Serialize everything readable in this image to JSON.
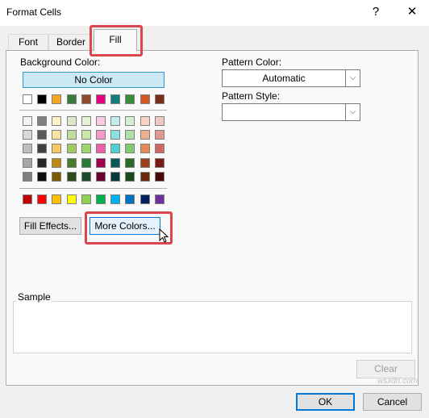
{
  "dialog": {
    "title": "Format Cells",
    "help_label": "?",
    "close_label": "✕"
  },
  "tabs": [
    {
      "label": "Font",
      "selected": false
    },
    {
      "label": "Border",
      "selected": false
    },
    {
      "label": "Fill",
      "selected": true
    }
  ],
  "fill": {
    "background_color_label": "Background Color:",
    "no_color_label": "No Color",
    "pattern_color_label": "Pattern Color:",
    "pattern_color_value": "Automatic",
    "pattern_style_label": "Pattern Style:",
    "pattern_style_value": "",
    "fill_effects_label": "Fill Effects...",
    "more_colors_label": "More Colors...",
    "sample_label": "Sample",
    "clear_label": "Clear"
  },
  "palette": {
    "theme_top": [
      "#ffffff",
      "#000000",
      "#f5a623",
      "#3c7a3c",
      "#8e4d2a",
      "#e5007e",
      "#137b7b",
      "#3a8c3a",
      "#d35a1e",
      "#7a2b1a"
    ],
    "theme_rows": [
      [
        "#f2f2f2",
        "#7f7f7f",
        "#fdf0c8",
        "#dde9c6",
        "#e6f2d5",
        "#fac9e3",
        "#c4eaea",
        "#d6eed4",
        "#f7d3c0",
        "#f0c8c4"
      ],
      [
        "#d9d9d9",
        "#595959",
        "#fbe2a0",
        "#c2dc9a",
        "#c8e8a8",
        "#f59ac8",
        "#8ee0e0",
        "#b0e0a8",
        "#f0b090",
        "#e09890"
      ],
      [
        "#bfbfbf",
        "#404040",
        "#f8c860",
        "#9fcb60",
        "#9fd468",
        "#ee5fa8",
        "#4fcfcf",
        "#80cc70",
        "#e8885a",
        "#d06a60"
      ],
      [
        "#a6a6a6",
        "#262626",
        "#c08a10",
        "#4a7a2a",
        "#2a7a3a",
        "#a00050",
        "#0a5a5a",
        "#2a6a2a",
        "#a0401a",
        "#7a1a1a"
      ],
      [
        "#7f7f7f",
        "#0d0d0d",
        "#7a5a00",
        "#2a4a1a",
        "#1a4a2a",
        "#6a0030",
        "#073a3a",
        "#1a4a1a",
        "#6a2a0a",
        "#4a0a0a"
      ]
    ],
    "standard": [
      "#c00000",
      "#ff0000",
      "#ffc000",
      "#ffff00",
      "#92d050",
      "#00b050",
      "#00b0f0",
      "#0070c0",
      "#002060",
      "#7030a0"
    ]
  },
  "buttons": {
    "ok_label": "OK",
    "cancel_label": "Cancel"
  },
  "watermark": "wsxdn.com",
  "colors": {
    "highlight": "#d9464c",
    "selection": "#cce8f4",
    "focus_border": "#0078d7"
  }
}
